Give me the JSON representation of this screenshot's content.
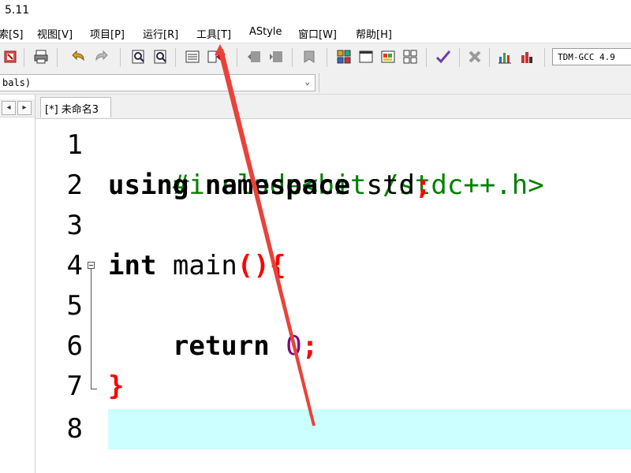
{
  "window": {
    "title": "5.11"
  },
  "menu": {
    "items": [
      {
        "label": "索[S]"
      },
      {
        "label": "视图[V]"
      },
      {
        "label": "项目[P]"
      },
      {
        "label": "运行[R]"
      },
      {
        "label": "工具[T]"
      },
      {
        "label": "AStyle"
      },
      {
        "label": "窗口[W]"
      },
      {
        "label": "帮助[H]"
      }
    ]
  },
  "toolbar": {
    "compiler_value": "TDM-GCC 4.9"
  },
  "class_combo": {
    "value": "bals)"
  },
  "nav": {
    "prev": "◂",
    "next": "▸"
  },
  "tab": {
    "label": "[*] 未命名3"
  },
  "editor": {
    "line_numbers": [
      "1",
      "2",
      "3",
      "4",
      "5",
      "6",
      "7",
      "8"
    ],
    "highlight_line": 8,
    "code": {
      "l1": "#include<bits/stdc++.h>",
      "l2_kw1": "using",
      "l2_kw2": "namespace",
      "l2_id": "std",
      "l2_semi": ";",
      "l4_kw": "int",
      "l4_id": "main",
      "l4_sym": "(){",
      "l6_kw": "return",
      "l6_num": "0",
      "l6_semi": ";",
      "l7_sym": "}"
    }
  },
  "colors": {
    "keyword": "#000000",
    "preprocessor": "#008000",
    "symbol": "#ff0000",
    "number": "#800080",
    "current_line": "#ccffff",
    "annotation_arrow": "#e8433a"
  }
}
